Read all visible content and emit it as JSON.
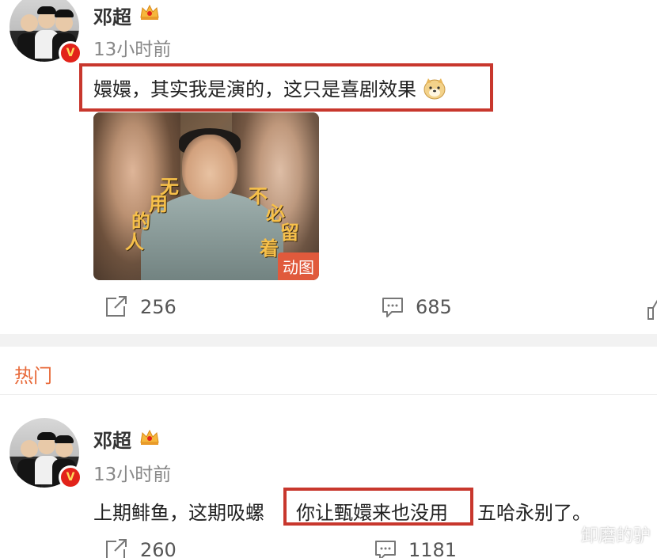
{
  "post": {
    "username": "邓超",
    "time": "13小时前",
    "text": "嬛嬛，其实我是演的，这只是喜剧效果",
    "media": {
      "captions": [
        "无",
        "用",
        "的",
        "人",
        "不",
        "必",
        "留",
        "着"
      ],
      "gif_label": "动图"
    },
    "actions": {
      "repost_count": "256",
      "comment_count": "685"
    }
  },
  "section": {
    "hot_label": "热门"
  },
  "comment": {
    "username": "邓超",
    "time": "13小时前",
    "text_before": "上期鲱鱼，这期吸螺",
    "text_highlight": "你让甄嬛来也没用",
    "text_after": "五哈永别了。",
    "actions": {
      "repost_count": "260",
      "comment_count": "1181"
    }
  },
  "watermark": "卸磨的驴",
  "colors": {
    "highlight_border": "#c8372d",
    "hot_label": "#e86a3a",
    "verified_badge": "#e2231a"
  },
  "icons": {
    "repost": "repost-icon",
    "comment": "comment-icon",
    "like": "like-icon",
    "crown": "crown-icon",
    "emoji": "doge-emoji-icon",
    "verified": "verified-v-icon"
  }
}
